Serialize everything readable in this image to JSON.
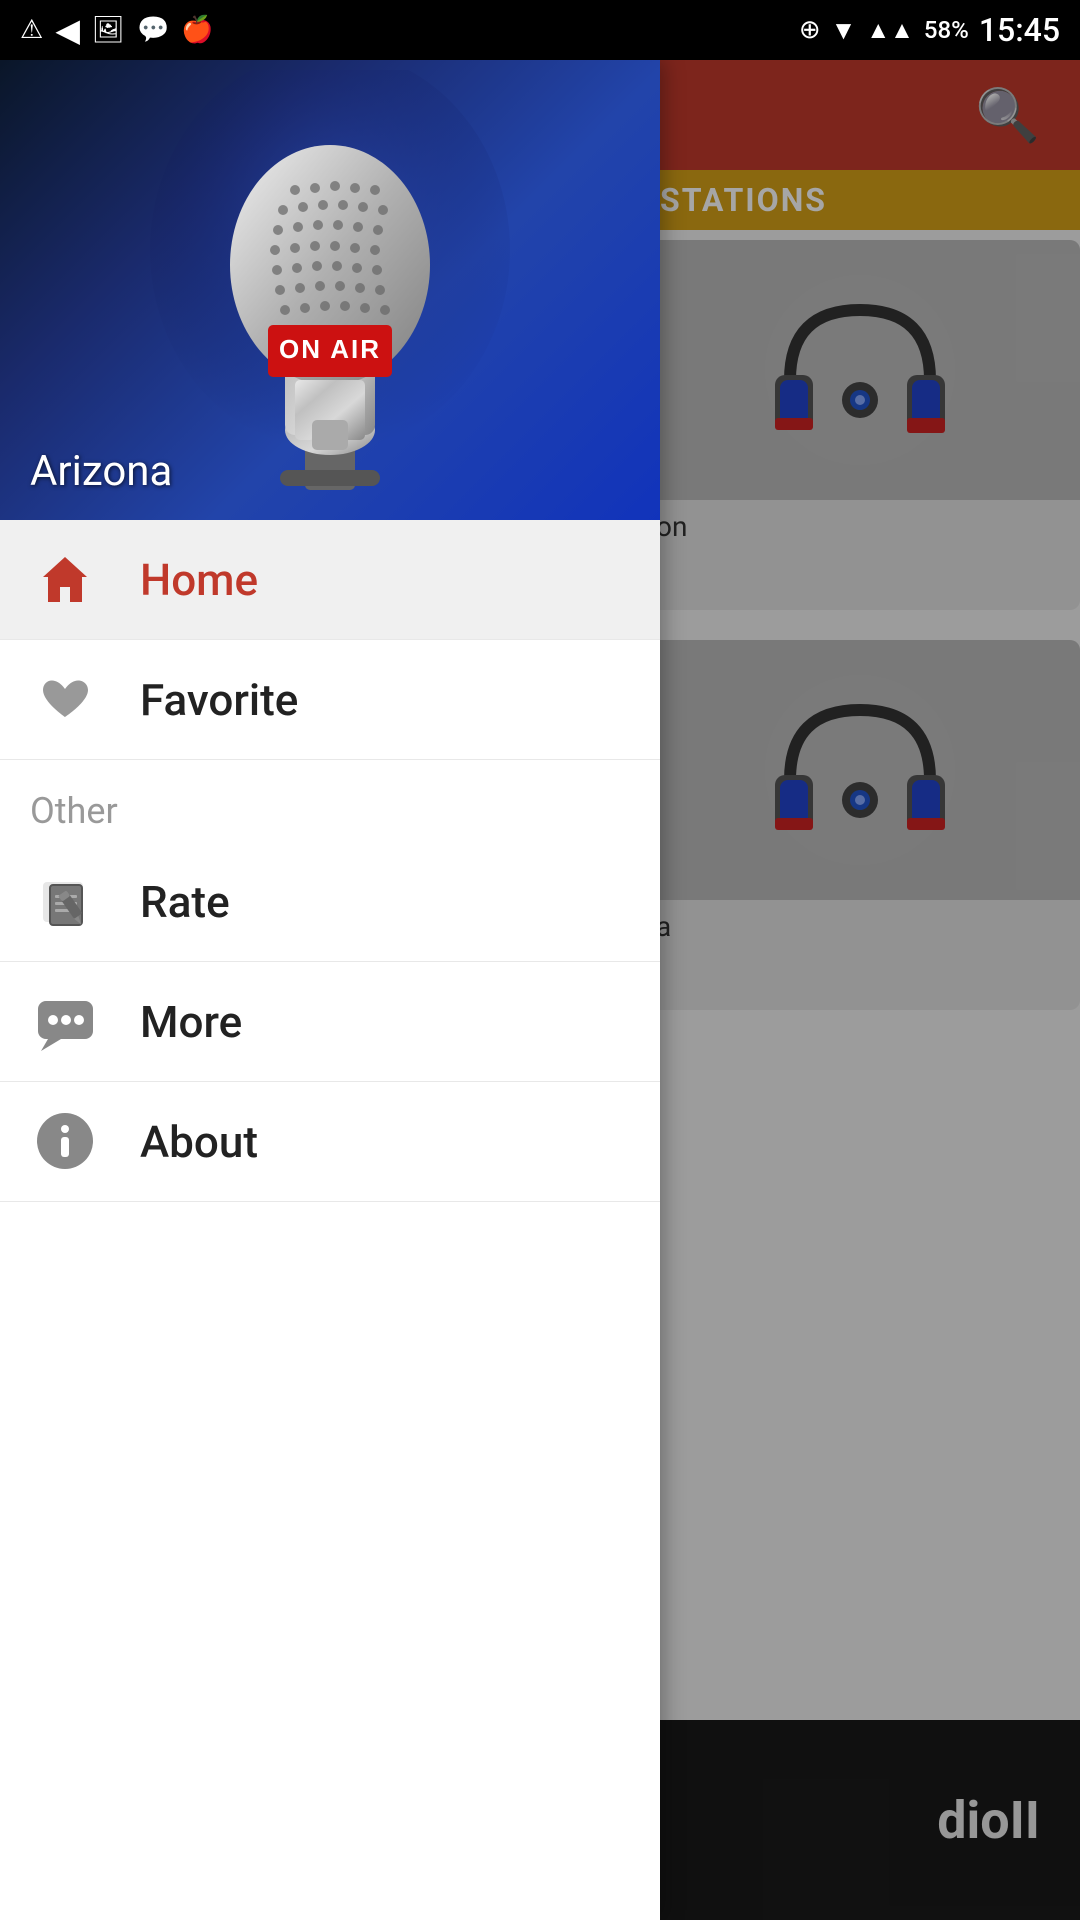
{
  "statusBar": {
    "time": "15:45",
    "battery": "58%"
  },
  "appHeader": {
    "searchIconLabel": "search-icon"
  },
  "stationsSection": {
    "label": "STATIONS"
  },
  "hero": {
    "cityLabel": "Arizona",
    "onAirText": "ON AIR"
  },
  "navItems": {
    "home": {
      "label": "Home",
      "active": true
    },
    "favorite": {
      "label": "Favorite",
      "active": false
    }
  },
  "otherSection": {
    "header": "Other",
    "items": [
      {
        "key": "rate",
        "label": "Rate"
      },
      {
        "key": "more",
        "label": "More"
      },
      {
        "key": "about",
        "label": "About"
      }
    ]
  },
  "stationCards": [
    {
      "name": "on"
    },
    {
      "name": "a"
    }
  ],
  "bottomBar": {
    "text": "dioII"
  }
}
